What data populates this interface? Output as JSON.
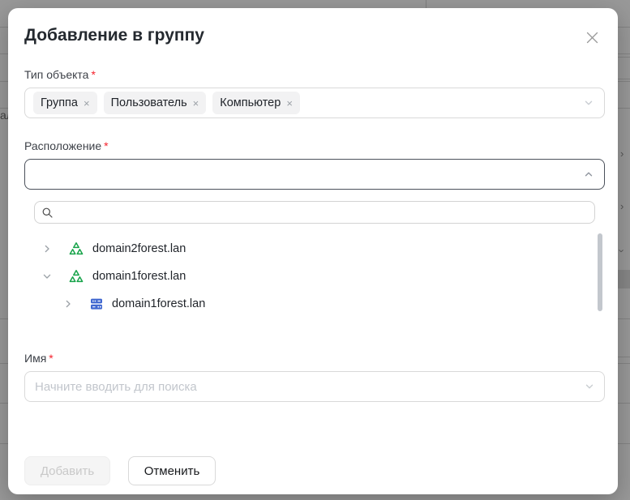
{
  "background": {
    "text_fragment": "ал"
  },
  "modal": {
    "title": "Добавление в группу",
    "fields": {
      "object_type": {
        "label": "Тип объекта",
        "required_mark": "*",
        "tags": [
          {
            "label": "Группа",
            "remove_icon": "×"
          },
          {
            "label": "Пользователь",
            "remove_icon": "×"
          },
          {
            "label": "Компьютер",
            "remove_icon": "×"
          }
        ]
      },
      "location": {
        "label": "Расположение",
        "required_mark": "*",
        "value": "",
        "state": "open"
      },
      "name": {
        "label": "Имя",
        "required_mark": "*",
        "value": "",
        "placeholder": "Начните вводить для поиска"
      }
    },
    "location_dropdown": {
      "search": {
        "value": "",
        "icon": "search-icon"
      },
      "tree": [
        {
          "label": "domain2forest.lan",
          "icon": "forest-icon",
          "level": 0,
          "expanded": false
        },
        {
          "label": "domain1forest.lan",
          "icon": "forest-icon",
          "level": 0,
          "expanded": true
        },
        {
          "label": "domain1forest.lan",
          "icon": "domain-icon",
          "level": 1,
          "expanded": false
        }
      ]
    },
    "buttons": {
      "submit": {
        "label": "Добавить",
        "disabled": true
      },
      "cancel": {
        "label": "Отменить",
        "disabled": false
      }
    }
  },
  "colors": {
    "overlay": "rgba(0,0,0,0.4)",
    "required_red": "#f5222d",
    "forest_icon_green": "#17a34a",
    "domain_icon_blue": "#4168d0",
    "border_gray": "#d9d9d9",
    "focused_border": "#4b515b",
    "tag_bg": "#f2f2f3",
    "disabled_btn_bg": "#f5f5f5"
  }
}
